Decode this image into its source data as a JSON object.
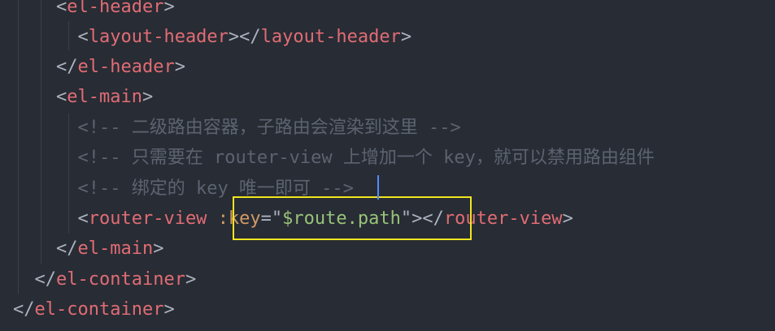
{
  "editor": {
    "theme_colors": {
      "background": "#282c34",
      "tag": "#e06c75",
      "punctuation": "#abb2bf",
      "comment": "#5c6370",
      "attribute": "#d19a66",
      "string": "#98c379",
      "highlight_box": "#f2e51f",
      "cursor": "#528bff"
    },
    "lines": [
      {
        "indent": "    ",
        "tokens": [
          {
            "type": "punct",
            "text": "<"
          },
          {
            "type": "tag",
            "text": "el-header"
          },
          {
            "type": "punct",
            "text": ">"
          }
        ]
      },
      {
        "indent": "      ",
        "tokens": [
          {
            "type": "punct",
            "text": "<"
          },
          {
            "type": "tag",
            "text": "layout-header"
          },
          {
            "type": "punct",
            "text": "></"
          },
          {
            "type": "tag",
            "text": "layout-header"
          },
          {
            "type": "punct",
            "text": ">"
          }
        ]
      },
      {
        "indent": "    ",
        "tokens": [
          {
            "type": "punct",
            "text": "</"
          },
          {
            "type": "tag",
            "text": "el-header"
          },
          {
            "type": "punct",
            "text": ">"
          }
        ]
      },
      {
        "indent": "    ",
        "tokens": [
          {
            "type": "punct",
            "text": "<"
          },
          {
            "type": "tag",
            "text": "el-main"
          },
          {
            "type": "punct",
            "text": ">"
          }
        ]
      },
      {
        "indent": "      ",
        "tokens": [
          {
            "type": "comment",
            "text": "<!-- 二级路由容器，子路由会渲染到这里 -->"
          }
        ]
      },
      {
        "indent": "      ",
        "tokens": [
          {
            "type": "comment",
            "text": "<!-- 只需要在 router-view 上增加一个 key，就可以禁用路由组件"
          }
        ]
      },
      {
        "indent": "      ",
        "tokens": [
          {
            "type": "comment",
            "text": "<!-- 绑定的 key 唯一即可 -->"
          }
        ]
      },
      {
        "indent": "      ",
        "tokens": [
          {
            "type": "punct",
            "text": "<"
          },
          {
            "type": "tag",
            "text": "router-view"
          },
          {
            "type": "punct",
            "text": " "
          },
          {
            "type": "attr",
            "text": ":key"
          },
          {
            "type": "punct",
            "text": "=\""
          },
          {
            "type": "str",
            "text": "$route.path"
          },
          {
            "type": "punct",
            "text": "\"></"
          },
          {
            "type": "tag",
            "text": "router-view"
          },
          {
            "type": "punct",
            "text": ">"
          }
        ]
      },
      {
        "indent": "    ",
        "tokens": [
          {
            "type": "punct",
            "text": "</"
          },
          {
            "type": "tag",
            "text": "el-main"
          },
          {
            "type": "punct",
            "text": ">"
          }
        ]
      },
      {
        "indent": "  ",
        "tokens": [
          {
            "type": "punct",
            "text": "</"
          },
          {
            "type": "tag",
            "text": "el-container"
          },
          {
            "type": "punct",
            "text": ">"
          }
        ]
      },
      {
        "indent": "",
        "tokens": [
          {
            "type": "punct",
            "text": "</"
          },
          {
            "type": "tag",
            "text": "el-container"
          },
          {
            "type": "punct",
            "text": ">"
          }
        ]
      }
    ]
  }
}
